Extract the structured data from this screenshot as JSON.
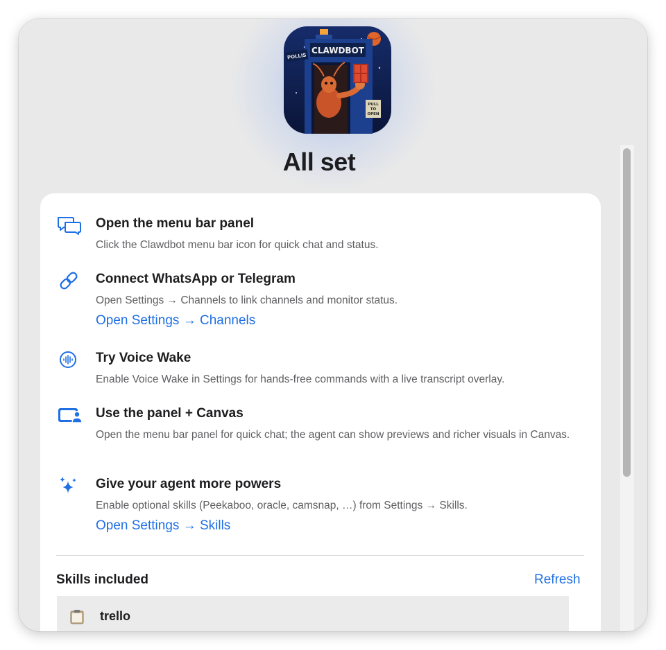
{
  "header": {
    "title": "All set"
  },
  "app_icon": {
    "label_left": "POLLIS",
    "label_top": "CLAWDBOT",
    "sign": [
      "PULL",
      "TO",
      "OPEN"
    ]
  },
  "steps": [
    {
      "icon": "chat-bubbles-icon",
      "title": "Open the menu bar panel",
      "desc": "Click the Clawdbot menu bar icon for quick chat and status."
    },
    {
      "icon": "link-icon",
      "title": "Connect WhatsApp or Telegram",
      "desc": "Open Settings → Channels to link channels and monitor status.",
      "link": "Open Settings → Channels"
    },
    {
      "icon": "waveform-circle-icon",
      "title": "Try Voice Wake",
      "desc": "Enable Voice Wake in Settings for hands-free commands with a live transcript overlay."
    },
    {
      "icon": "display-person-icon",
      "title": "Use the panel + Canvas",
      "desc": "Open the menu bar panel for quick chat; the agent can show previews and richer visuals in Canvas."
    },
    {
      "icon": "sparkles-icon",
      "title": "Give your agent more powers",
      "desc": "Enable optional skills (Peekaboo, oracle, camsnap, …) from Settings → Skills.",
      "link": "Open Settings → Skills"
    }
  ],
  "skills": {
    "title": "Skills included",
    "refresh_label": "Refresh",
    "items": [
      {
        "icon": "clipboard-icon",
        "name": "trello"
      }
    ]
  },
  "colors": {
    "accent": "#1f6fe5",
    "window_bg": "#e9e9e9",
    "card_bg": "#ffffff"
  }
}
